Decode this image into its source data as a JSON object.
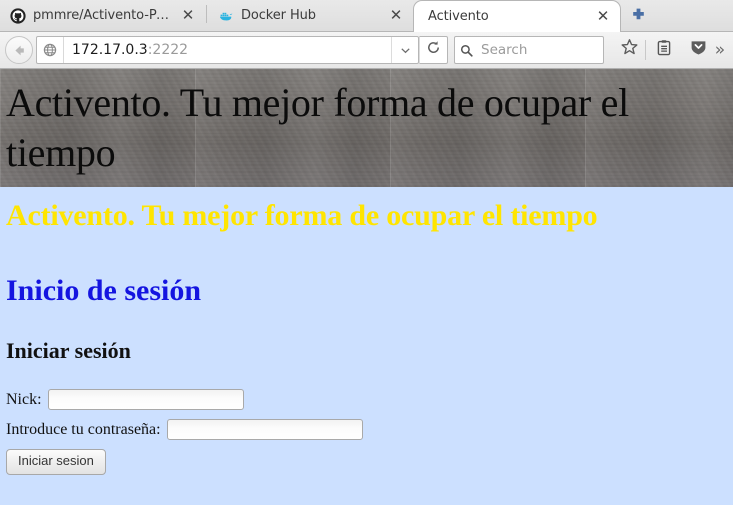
{
  "browser": {
    "tabs": [
      {
        "title": "pmmre/Activento-Pa...",
        "favicon": "github-icon",
        "active": false,
        "close_label": "✕"
      },
      {
        "title": "Docker Hub",
        "favicon": "docker-whale-icon",
        "active": false,
        "close_label": "✕"
      },
      {
        "title": "Activento",
        "favicon": "none",
        "active": true,
        "close_label": "✕"
      }
    ],
    "new_tab_label": "+",
    "toolbar": {
      "back_icon": "back-arrow-icon",
      "site_identity_icon": "globe-icon",
      "url_host": "172.17.0.3",
      "url_port": ":2222",
      "dropdown_icon": "chevron-down-icon",
      "reload_icon": "reload-icon",
      "search_placeholder": "Search",
      "search_icon": "search-icon",
      "bookmark_icon": "star-icon",
      "reader_icon": "clipboard-icon",
      "downloads_icon": "shield-down-icon",
      "overflow_label": "»"
    }
  },
  "page": {
    "banner_title": "Activento. Tu mejor forma de ocupar el tiempo",
    "heading_yellow": "Activento. Tu mejor forma de ocupar el tiempo",
    "heading_blue": "Inicio de sesión",
    "heading_black": "Iniciar sesión",
    "form": {
      "nick_label": "Nick:",
      "nick_value": "",
      "nick_placeholder": "",
      "password_label": "Introduce tu contraseña:",
      "password_value": "",
      "password_placeholder": "",
      "submit_label": "Iniciar sesion"
    },
    "colors": {
      "background": "#cce0ff",
      "heading_yellow": "#ffe500",
      "heading_blue": "#1414e0",
      "banner_text": "#0b0b0b"
    }
  }
}
